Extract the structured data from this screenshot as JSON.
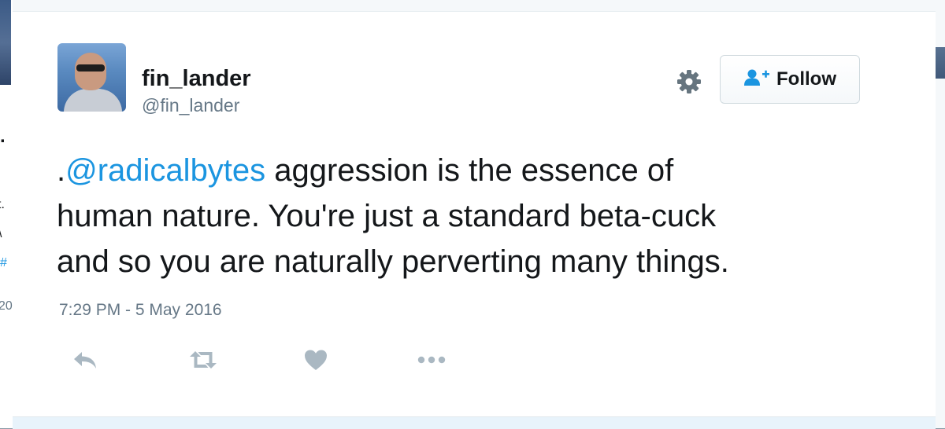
{
  "background": {
    "fragments": [
      "t.",
      "\\",
      "#",
      "20"
    ]
  },
  "tweet": {
    "display_name": "fin_lander",
    "handle": "@fin_lander",
    "text_prefix": ".",
    "mention": "@radicalbytes",
    "text_line1_rest": " aggression is the essence of",
    "text_line2": "human nature. You're just a standard beta-cuck",
    "text_line3": "and so you are naturally perverting many things.",
    "timestamp": "7:29 PM - 5 May 2016"
  },
  "follow_button": {
    "label": "Follow",
    "icon": "follow-user-icon"
  },
  "icons": {
    "settings": "gear-icon",
    "reply": "reply-icon",
    "retweet": "retweet-icon",
    "like": "heart-icon",
    "more": "more-dots-icon"
  },
  "colors": {
    "link": "#1b95e0",
    "text": "#14171a",
    "muted": "#657786",
    "icon": "#aab8c2"
  }
}
